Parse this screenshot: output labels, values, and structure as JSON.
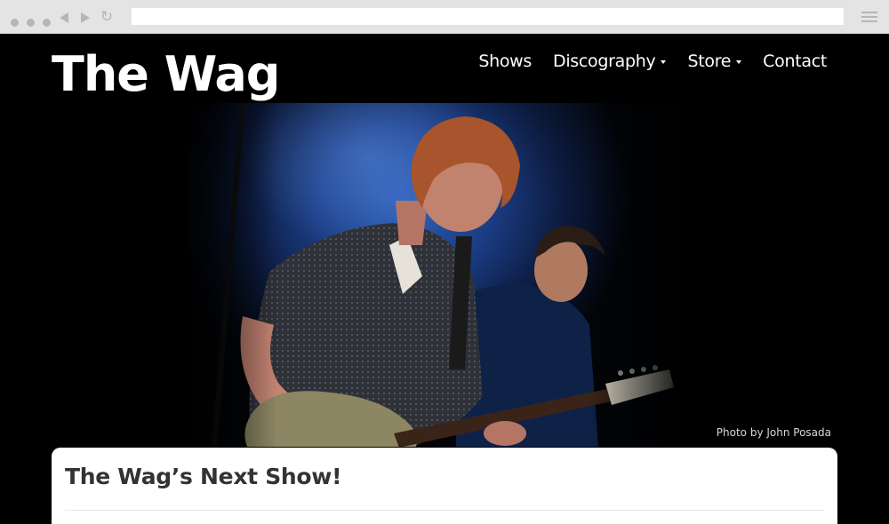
{
  "browser": {
    "address": "",
    "icons": [
      "window-dots",
      "back-arrow-icon",
      "forward-arrow-icon",
      "reload-icon",
      "hamburger-menu-icon"
    ]
  },
  "site": {
    "logo": "The Wag",
    "nav": [
      {
        "label": "Shows",
        "dropdown": false
      },
      {
        "label": "Discography",
        "dropdown": true
      },
      {
        "label": "Store",
        "dropdown": true
      },
      {
        "label": "Contact",
        "dropdown": false
      }
    ],
    "hero": {
      "credit": "Photo by John Posada"
    },
    "card": {
      "title": "The Wag’s Next Show!"
    }
  },
  "colors": {
    "background": "#000000",
    "chrome": "#e4e4e4",
    "card": "#ffffff",
    "title_text": "#333333",
    "stage_blue": "#2d5fb8"
  }
}
